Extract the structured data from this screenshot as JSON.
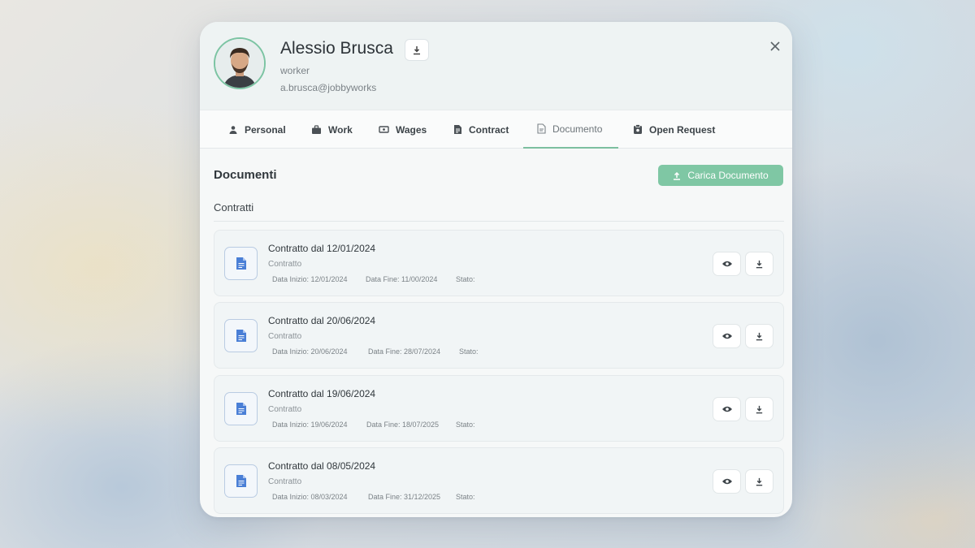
{
  "user": {
    "name": "Alessio Brusca",
    "role": "worker",
    "email": "a.brusca@jobbyworks"
  },
  "tabs": [
    {
      "label": "Personal",
      "icon": "person-icon"
    },
    {
      "label": "Work",
      "icon": "briefcase-icon"
    },
    {
      "label": "Wages",
      "icon": "wallet-icon"
    },
    {
      "label": "Contract",
      "icon": "contract-icon"
    },
    {
      "label": "Documento",
      "icon": "document-icon",
      "active": true
    },
    {
      "label": "Open Request",
      "icon": "request-icon"
    }
  ],
  "section": {
    "title": "Documenti",
    "upload_label": "Carica Documento",
    "group_title": "Contratti"
  },
  "documents": [
    {
      "title": "Contratto dal 12/01/2024",
      "type": "Contratto",
      "start": "Data Inizio: 12/01/2024",
      "end": "Data Fine: 11/00/2024",
      "status": "Stato:"
    },
    {
      "title": "Contratto dal 20/06/2024",
      "type": "Contratto",
      "start": "Data Inizio: 20/06/2024",
      "end": "Data Fine: 28/07/2024",
      "status": "Stato:"
    },
    {
      "title": "Contratto dal 19/06/2024",
      "type": "Contratto",
      "start": "Data Inizio: 19/06/2024",
      "end": "Data Fine: 18/07/2025",
      "status": "Stato:"
    },
    {
      "title": "Contratto dal 08/05/2024",
      "type": "Contratto",
      "start": "Data Inizio: 08/03/2024",
      "end": "Data Fine: 31/12/2025",
      "status": "Stato:"
    }
  ],
  "colors": {
    "accent": "#7fc7a4",
    "doc_icon": "#4a7fd6",
    "text": "#30373c"
  }
}
